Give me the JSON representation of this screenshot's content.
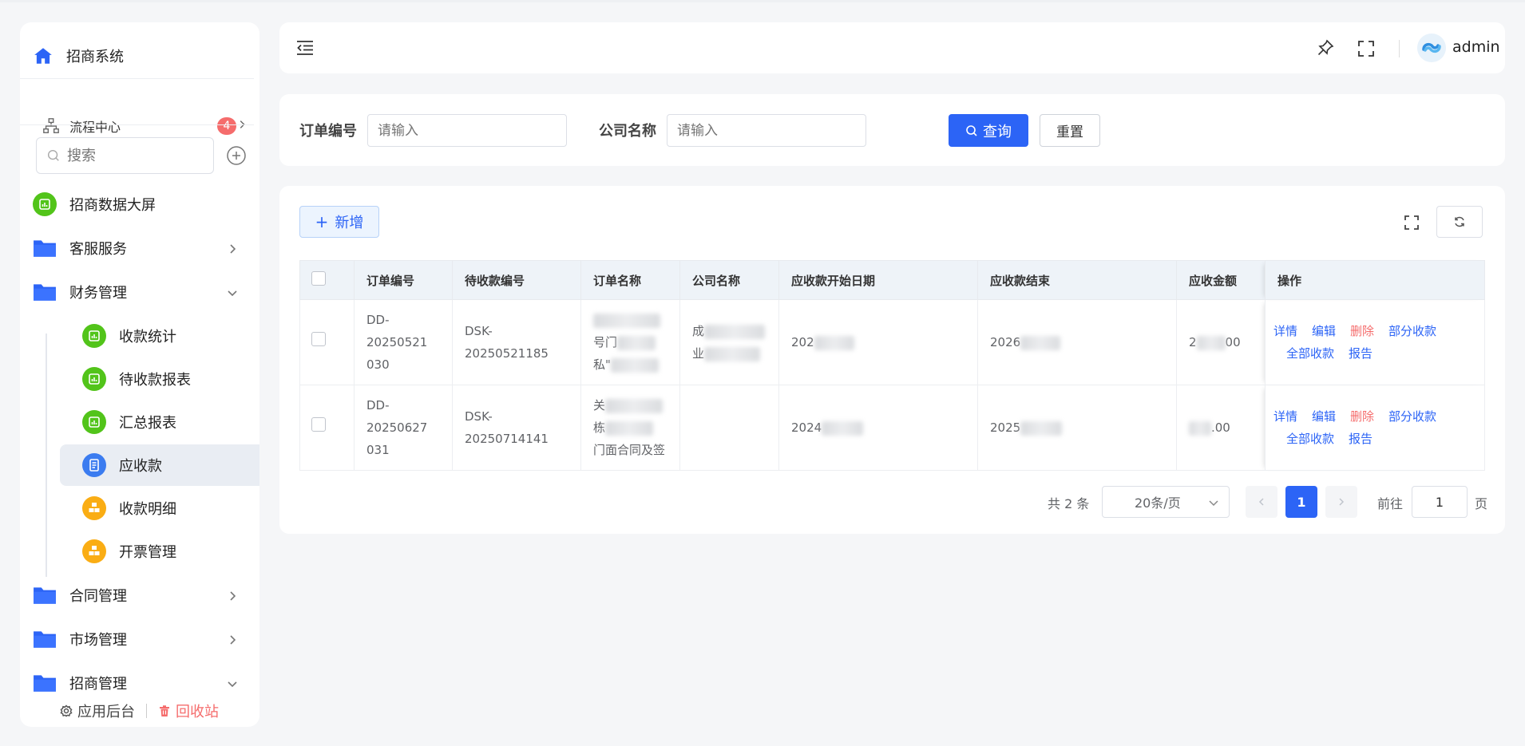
{
  "sidebar": {
    "brand": "招商系统",
    "flow": {
      "label": "流程中心",
      "badge": "4"
    },
    "search_placeholder": "搜索",
    "menu": {
      "dashboard": "招商数据大屏",
      "customer": "客服服务",
      "finance": "财务管理",
      "collect_stats": "收款统计",
      "pending_report": "待收款报表",
      "summary_report": "汇总报表",
      "receivable": "应收款",
      "collect_detail": "收款明细",
      "invoice": "开票管理",
      "contract": "合同管理",
      "market": "市场管理",
      "invest": "招商管理"
    },
    "footer": {
      "backend": "应用后台",
      "recycle": "回收站"
    }
  },
  "header": {
    "username": "admin"
  },
  "filter": {
    "order_no_label": "订单编号",
    "order_no_placeholder": "请输入",
    "company_label": "公司名称",
    "company_placeholder": "请输入",
    "query_label": "查询",
    "reset_label": "重置"
  },
  "toolbar": {
    "add_label": "新增"
  },
  "table": {
    "headers": [
      "订单编号",
      "待收款编号",
      "订单名称",
      "公司名称",
      "应收款开始日期",
      "应收款结束",
      "应收金额",
      "操作"
    ],
    "rows": [
      {
        "order_no_1": "DD-20250521",
        "order_no_2": "030",
        "pending_no": "DSK-20250521185",
        "name_1": "",
        "name_2": "号门",
        "name_3": "私\"",
        "company_1": "成",
        "company_2": "业",
        "start": "202",
        "end": "2026",
        "amount_pre": "2",
        "amount_suf": "00"
      },
      {
        "order_no_1": "DD-20250627",
        "order_no_2": "031",
        "pending_no": "DSK-20250714141",
        "name_1": "关",
        "name_2": "栋",
        "name_3": "门面合同及签",
        "company_1": "",
        "company_2": "",
        "start": "2024",
        "end": "2025",
        "amount_pre": "",
        "amount_suf": ".00"
      }
    ],
    "actions": {
      "detail": "详情",
      "edit": "编辑",
      "delete": "删除",
      "partial": "部分收款",
      "full": "全部收款",
      "report": "报告"
    }
  },
  "pagination": {
    "total": "共 2 条",
    "page_size": "20条/页",
    "current_page": "1",
    "goto_label": "前往",
    "goto_value": "1",
    "page_unit": "页"
  },
  "colors": {
    "primary": "#2c64f6",
    "danger": "#f56c6c",
    "green": "#52c41a",
    "orange": "#faad14"
  }
}
